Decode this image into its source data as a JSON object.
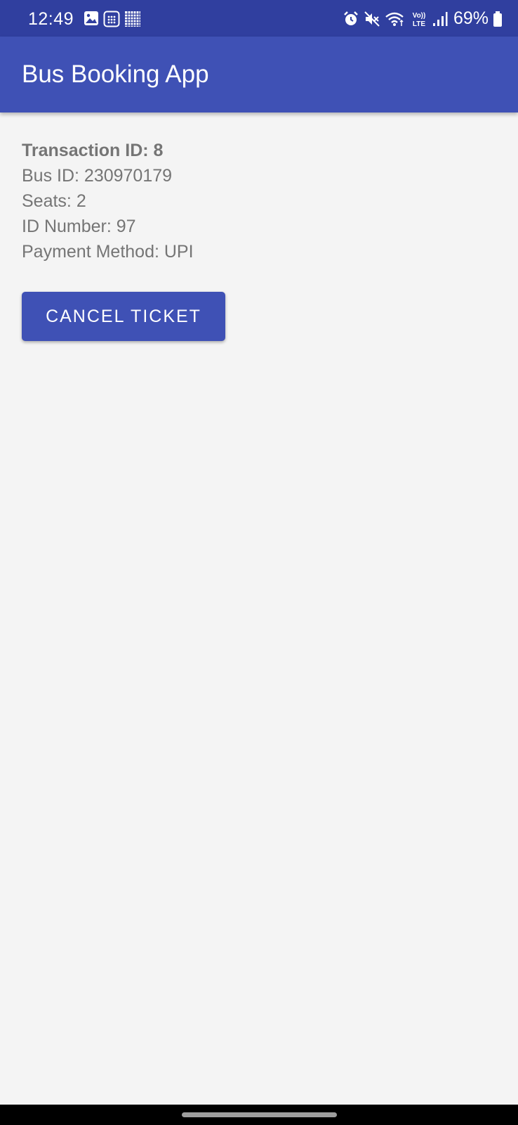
{
  "status_bar": {
    "time": "12:49",
    "battery": "69%",
    "left_icons": [
      "image-icon",
      "sim-card-icon",
      "grid-icon"
    ],
    "right_icons": [
      "alarm-icon",
      "mute-icon",
      "wifi-icon",
      "volte-icon",
      "signal-icon",
      "battery-icon"
    ],
    "volte_label_top": "Vo))",
    "volte_label_bottom": "LTE"
  },
  "app_bar": {
    "title": "Bus Booking App"
  },
  "ticket": {
    "transaction": "Transaction ID: 8",
    "bus_id": "Bus ID: 230970179",
    "seats": "Seats: 2",
    "id_number": "ID Number: 97",
    "payment_method": "Payment Method: UPI"
  },
  "actions": {
    "cancel_label": "CANCEL TICKET"
  },
  "colors": {
    "status_bar": "#303f9f",
    "primary": "#3f51b5",
    "background": "#f4f4f4",
    "text_secondary": "#757575"
  }
}
